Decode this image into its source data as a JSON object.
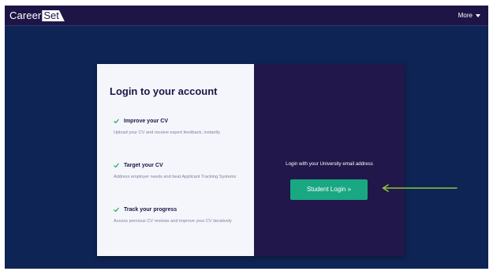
{
  "nav": {
    "logo_career": "Career",
    "logo_set": "Set",
    "more_label": "More"
  },
  "login": {
    "title": "Login to your account",
    "features": [
      {
        "title": "Improve your CV",
        "description": "Upload your CV and receive expert feedback, instantly"
      },
      {
        "title": "Target your CV",
        "description": "Address employer needs and beat Applicant Tracking Systems"
      },
      {
        "title": "Track your progress",
        "description": "Access previous CV reviews and improve your CV iteratively"
      }
    ],
    "instruction": "Login with your University email address",
    "button_label": "Student Login »"
  },
  "icons": {
    "feature": "check-icon",
    "menu": "caret-down-icon",
    "annotation": "arrow-left-icon"
  },
  "colors": {
    "background": "#0e2455",
    "nav_background": "#1e1546",
    "card_left": "#f4f6fc",
    "card_right": "#21174a",
    "accent_green": "#19a881",
    "check_green": "#27ae60",
    "annotation_green": "#8cc63f"
  }
}
